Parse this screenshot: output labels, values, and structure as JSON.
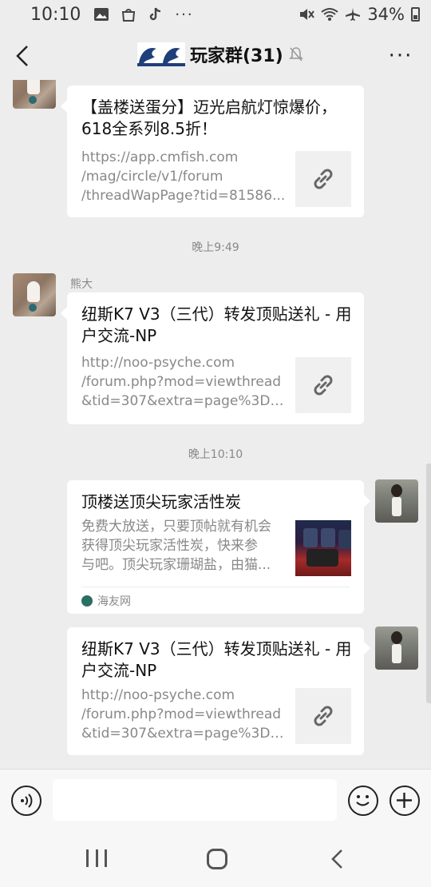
{
  "status_bar": {
    "time": "10:10",
    "battery": "34%"
  },
  "header": {
    "title": "玩家群(31)",
    "more_label": "···"
  },
  "messages": [
    {
      "title": "【盖楼送蛋分】迈光启航灯惊爆价，618全系列8.5折！",
      "desc": [
        "https://app.cmfish.com",
        "/mag/circle/v1/forum",
        "/threadWapPage?tid=81586..."
      ],
      "thumb": "link-icon"
    },
    {
      "time_label": "晚上9:49",
      "sender": "熊大",
      "title": "纽斯K7 V3（三代）转发顶贴送礼 - 用户交流-NP",
      "desc": [
        "http://noo-psyche.com",
        "/forum.php?mod=viewthread",
        "&tid=307&extra=page%3D1..."
      ],
      "thumb": "link-icon"
    },
    {
      "time_label": "晚上10:10",
      "title": "顶楼送顶尖玩家活性炭",
      "desc": [
        "免费大放送，只要顶帖就有机会",
        "获得顶尖玩家活性炭，快来参",
        "与吧。顶尖玩家珊瑚盐，由猫..."
      ],
      "source": "海友网"
    },
    {
      "title": "纽斯K7 V3（三代）转发顶贴送礼 - 用户交流-NP",
      "desc": [
        "http://noo-psyche.com",
        "/forum.php?mod=viewthread",
        "&tid=307&extra=page%3D1..."
      ],
      "thumb": "link-icon"
    }
  ],
  "input": {
    "placeholder": ""
  }
}
